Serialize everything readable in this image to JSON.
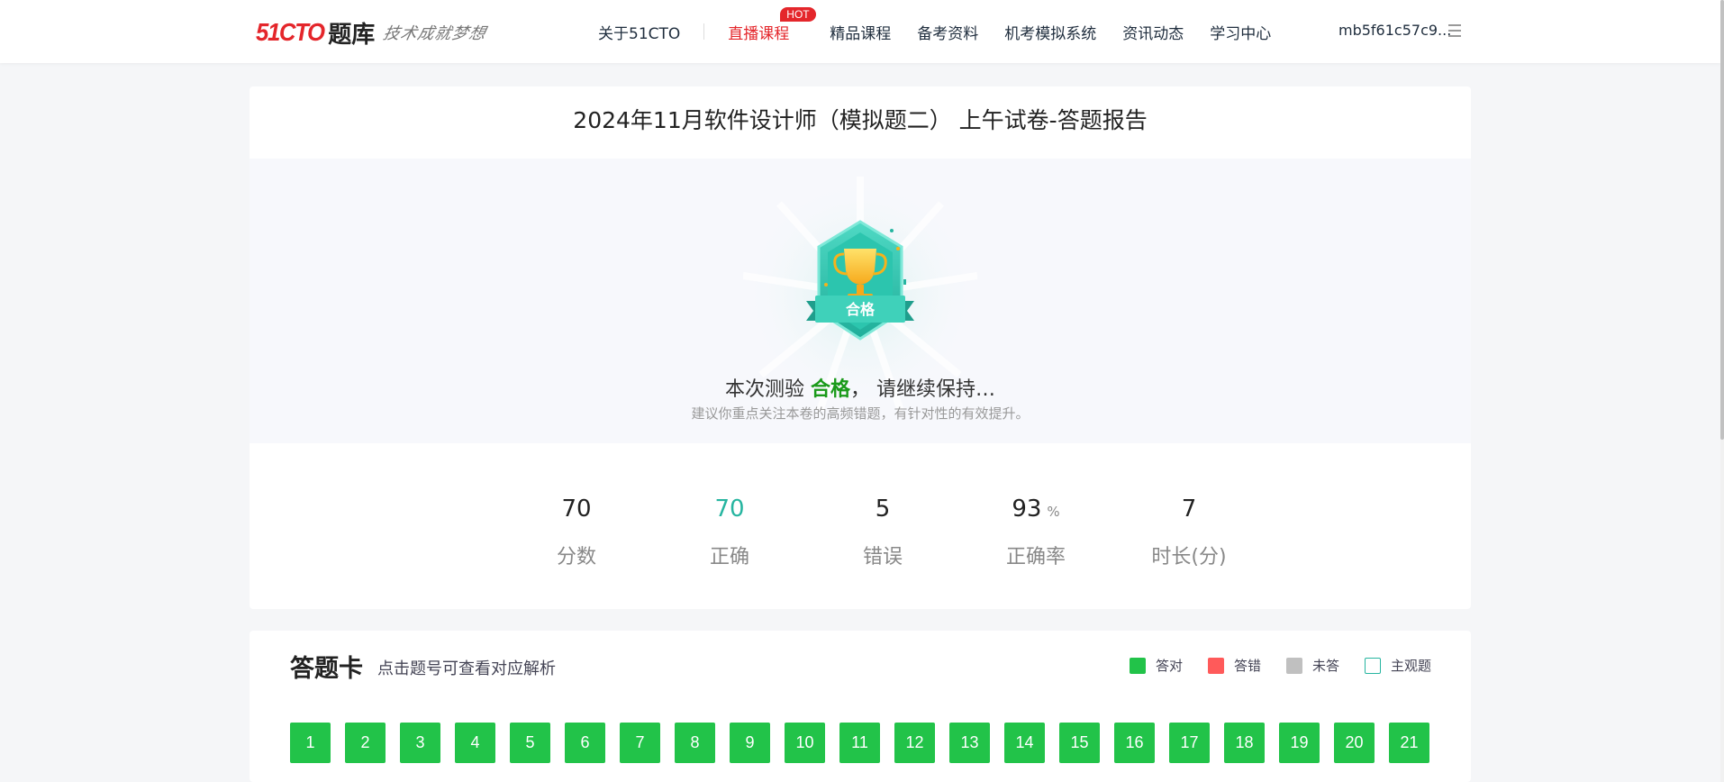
{
  "header": {
    "logo_brand": "51CTO",
    "logo_product": "题库",
    "logo_slogan": "技术成就梦想",
    "nav": {
      "about": "关于51CTO",
      "live": "直播课程",
      "hot_badge": "HOT",
      "courses": "精品课程",
      "materials": "备考资料",
      "mock_system": "机考模拟系统",
      "news": "资讯动态",
      "learning_center": "学习中心"
    },
    "username": "mb5f61c57c9...",
    "colors": {
      "brand": "#e4262b"
    }
  },
  "report": {
    "title": "2024年11月软件设计师（模拟题二） 上午试卷-答题报告",
    "badge_label": "合格",
    "verdict_prefix": "本次测验",
    "verdict_word": "合格",
    "verdict_suffix": "， 请继续保持…",
    "advice": "建议你重点关注本卷的高频错题，有针对性的有效提升。",
    "stats": [
      {
        "value": "70",
        "unit": "",
        "label": "分数"
      },
      {
        "value": "70",
        "unit": "",
        "label": "正确"
      },
      {
        "value": "5",
        "unit": "",
        "label": "错误"
      },
      {
        "value": "93",
        "unit": "%",
        "label": "正确率"
      },
      {
        "value": "7",
        "unit": "",
        "label": "时长(分)"
      }
    ]
  },
  "answer_card": {
    "title": "答题卡",
    "hint": "点击题号可查看对应解析",
    "legend": [
      {
        "label": "答对",
        "color": "#22c349"
      },
      {
        "label": "答错",
        "color": "#ff5a5a"
      },
      {
        "label": "未答",
        "color": "#c0c0c0"
      },
      {
        "label": "主观题",
        "color": "#26b5a0"
      }
    ],
    "questions": [
      "1",
      "2",
      "3",
      "4",
      "5",
      "6",
      "7",
      "8",
      "9",
      "10",
      "11",
      "12",
      "13",
      "14",
      "15",
      "16",
      "17",
      "18",
      "19",
      "20",
      "21"
    ]
  }
}
